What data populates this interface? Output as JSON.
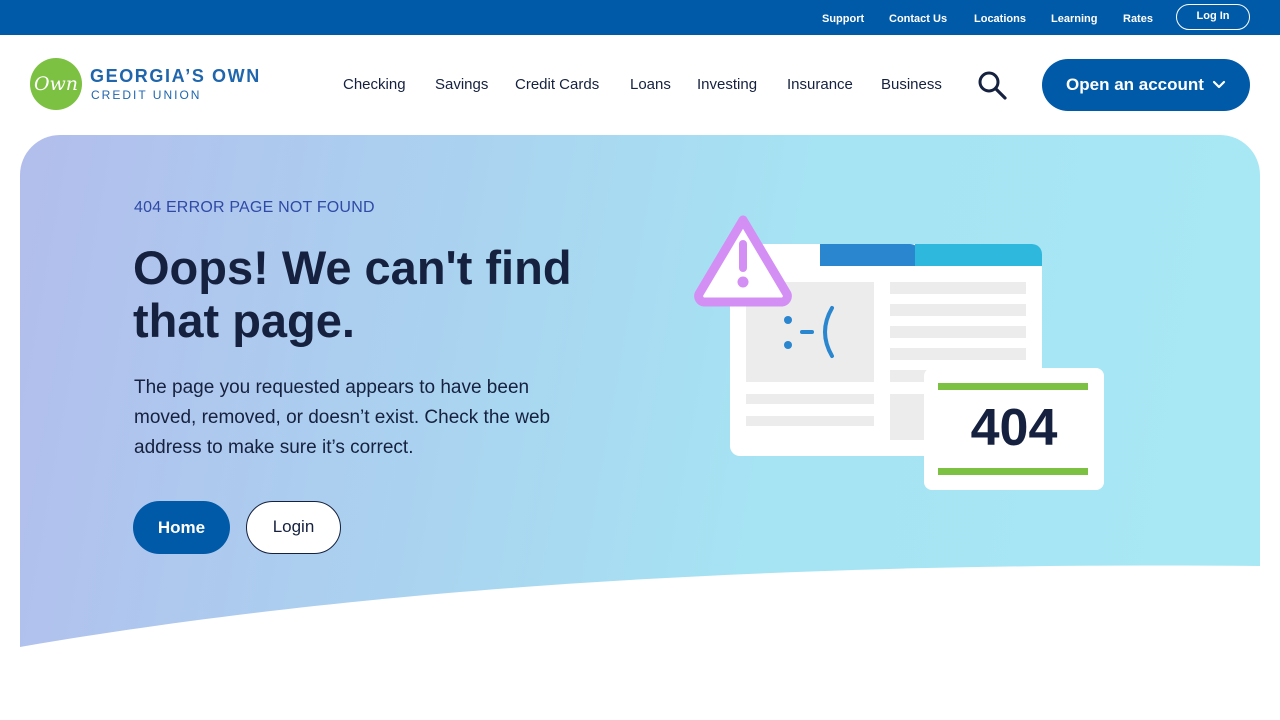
{
  "topbar": {
    "links": [
      "Support",
      "Contact Us",
      "Locations",
      "Learning",
      "Rates"
    ],
    "login_label": "Log In"
  },
  "logo": {
    "mark": "Own",
    "line1": "GEORGIA’S OWN",
    "line2": "CREDIT UNION"
  },
  "nav": {
    "items": [
      "Checking",
      "Savings",
      "Credit Cards",
      "Loans",
      "Investing",
      "Insurance",
      "Business"
    ],
    "search_icon": "search-icon",
    "cta_label": "Open an account"
  },
  "hero": {
    "eyebrow": "404 ERROR PAGE NOT FOUND",
    "headline": "Oops! We can't find that page.",
    "body": "The page you requested appears to have been moved, removed, or doesn’t exist. Check the web address to make sure it’s correct.",
    "home_label": "Home",
    "login_label": "Login"
  },
  "illustration": {
    "face_text": ":-(",
    "code": "404",
    "icons": [
      "warning-icon"
    ]
  },
  "colors": {
    "brand_blue": "#005aa7",
    "logo_green": "#7cc142",
    "warning_purple": "#d48ff5",
    "accent_green": "#7cc142",
    "text_dark": "#15213f"
  }
}
